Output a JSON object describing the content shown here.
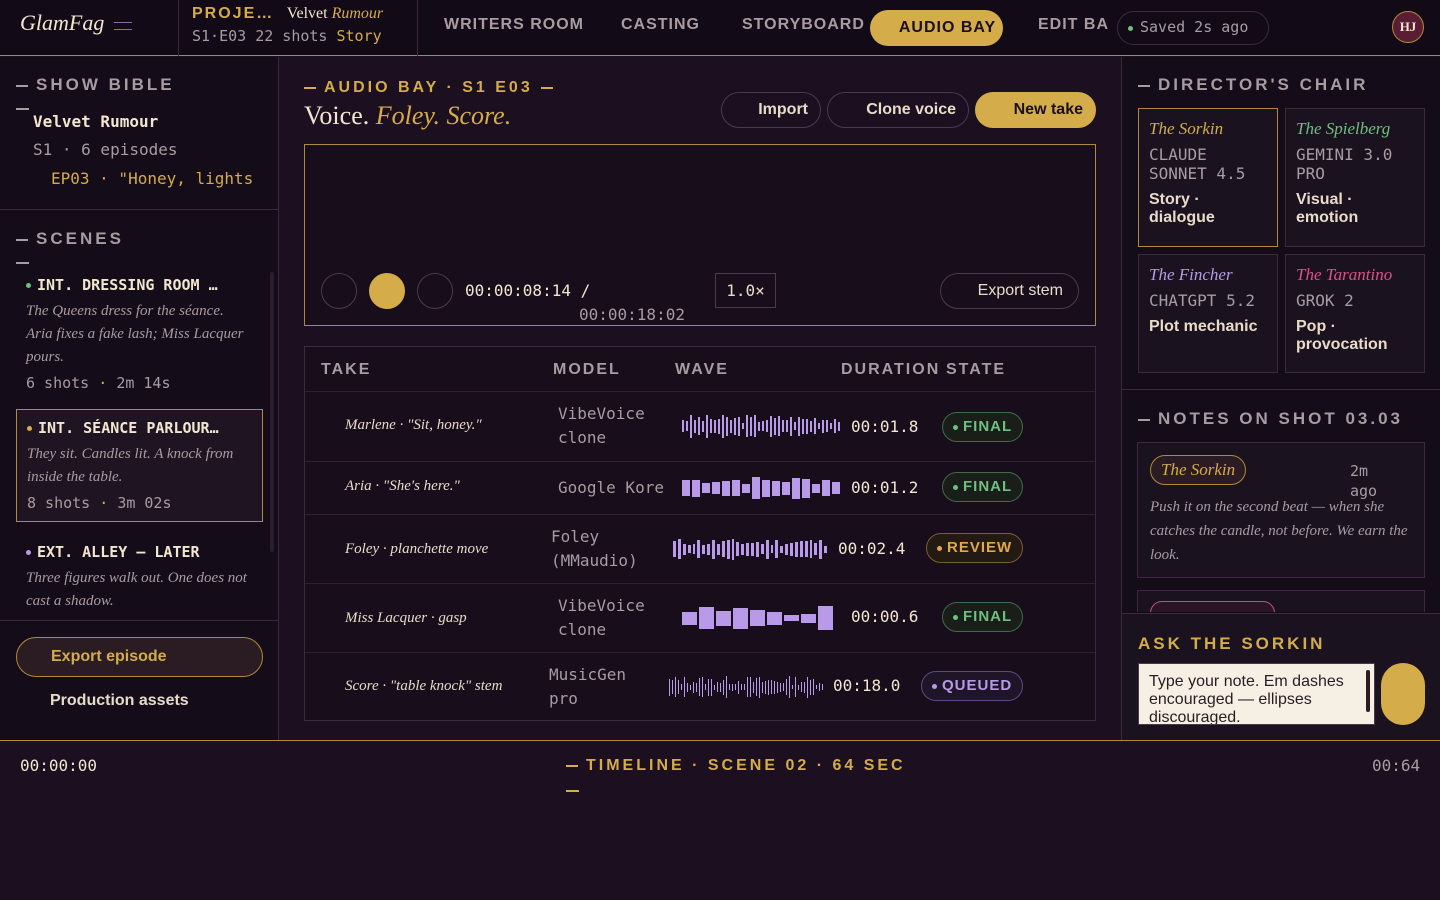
{
  "topbar": {
    "logo": "GlamFag",
    "project_label": "PROJE…",
    "project_title_a": "Velvet ",
    "project_title_b": "Rumour",
    "project_ep": "S1·E03",
    "project_shots": "22 shots",
    "project_status": "Story",
    "nav": [
      "WRITERS ROOM",
      "CASTING",
      "STORYBOARD",
      "AUDIO BAY",
      "EDIT BA"
    ],
    "active_nav": "AUDIO BAY",
    "saved": "Saved 2s ago",
    "avatar": "HJ"
  },
  "left": {
    "bible_header": "SHOW BIBLE",
    "bible_title": "Velvet Rumour",
    "bible_season": "S1 · 6 episodes",
    "bible_episode": "EP03 · \"Honey, lights",
    "scenes_header": "SCENES",
    "scenes": [
      {
        "heading": "INT. DRESSING ROOM …",
        "desc": "The Queens dress for the séance. Aria fixes a fake lash; Miss Lacquer pours.",
        "shots": "6 shots",
        "duration": "2m 14s",
        "dot_color": "#6fbf7f"
      },
      {
        "heading": "INT. SÉANCE PARLOUR…",
        "desc": "They sit. Candles lit. A knock from inside the table.",
        "shots": "8 shots",
        "duration": "3m 02s",
        "dot_color": "#d4ac4a"
      },
      {
        "heading": "EXT. ALLEY — LATER",
        "desc": "Three figures walk out. One does not cast a shadow.",
        "dot_color": "#b99ae8"
      }
    ],
    "export_episode": "Export episode",
    "production_assets": "Production assets"
  },
  "main": {
    "section_label": "AUDIO BAY · S1 E03",
    "title_a": "Voice. ",
    "title_b": "Foley. Score.",
    "import_label": "Import",
    "clone_label": "Clone voice",
    "new_take_label": "New take",
    "timecode_current": "00:00:08:14 /",
    "timecode_total": "00:00:18:02",
    "speed": "1.0×",
    "export_stem": "Export stem",
    "table_headers": {
      "take": "TAKE",
      "model": "MODEL",
      "wave": "WAVE",
      "duration": "DURATION",
      "state": "STATE"
    },
    "takes": [
      {
        "take": "Marlene · \"Sit, honey.\"",
        "model": [
          "VibeVoice",
          "clone"
        ],
        "duration": "00:01.8",
        "state": "FINAL"
      },
      {
        "take": "Aria · \"She's here.\"",
        "model": [
          "Google Kore"
        ],
        "duration": "00:01.2",
        "state": "FINAL"
      },
      {
        "take": "Foley · planchette move",
        "model": [
          "Foley",
          "(MMaudio)"
        ],
        "duration": "00:02.4",
        "state": "REVIEW"
      },
      {
        "take": "Miss Lacquer · gasp",
        "model": [
          "VibeVoice",
          "clone"
        ],
        "duration": "00:00.6",
        "state": "FINAL"
      },
      {
        "take": "Score · \"table knock\" stem",
        "model": [
          "MusicGen",
          "pro"
        ],
        "duration": "00:18.0",
        "state": "QUEUED"
      }
    ],
    "wave_color": "#b99ae8"
  },
  "right": {
    "director_header": "DIRECTOR'S CHAIR",
    "directors": [
      {
        "name": "The Sorkin",
        "model": "CLAUDE SONNET 4.5",
        "role": "Story · dialogue",
        "color": "#d4ac4a"
      },
      {
        "name": "The Spielberg",
        "model": "GEMINI 3.0 PRO",
        "role": "Visual · emotion",
        "color": "#6fbf7f"
      },
      {
        "name": "The Fincher",
        "model": "CHATGPT 5.2",
        "role": "Plot mechanic",
        "color": "#b99ae8"
      },
      {
        "name": "The Tarantino",
        "model": "GROK 2",
        "role": "Pop · provocation",
        "color": "#e0508a"
      }
    ],
    "notes_header": "NOTES ON SHOT 03.03",
    "note": {
      "author": "The Sorkin",
      "ago": "2m ago",
      "text": "Push it on the second beat — when she catches the candle, not before. We earn the look."
    },
    "ask_header": "ASK THE SORKIN",
    "ask_placeholder": "Type your note. Em dashes encouraged — ellipses discouraged."
  },
  "timeline": {
    "start": "00:00:00",
    "label": "TIMELINE · SCENE 02 · 64 SEC",
    "end": "00:64"
  }
}
